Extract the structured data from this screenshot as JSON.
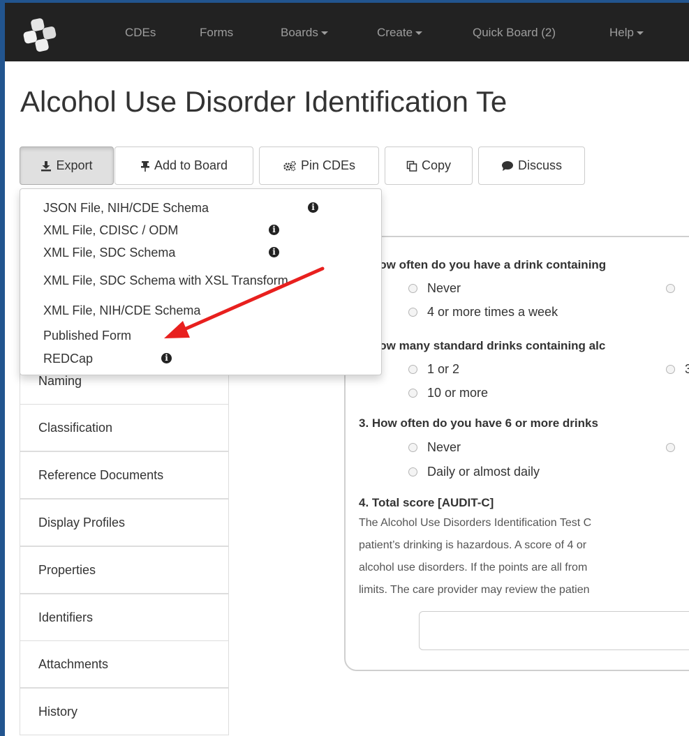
{
  "navbar": {
    "items": [
      {
        "label": "CDEs",
        "dropdown": false
      },
      {
        "label": "Forms",
        "dropdown": false
      },
      {
        "label": "Boards",
        "dropdown": true
      },
      {
        "label": "Create",
        "dropdown": true
      },
      {
        "label": "Quick Board (2)",
        "dropdown": false
      },
      {
        "label": "Help",
        "dropdown": true
      }
    ]
  },
  "page": {
    "title": "Alcohol Use Disorder Identification Te"
  },
  "toolbar": {
    "export_label": "Export",
    "add_to_board_label": "Add to Board",
    "pin_cdes_label": "Pin CDEs",
    "copy_label": "Copy",
    "discuss_label": "Discuss"
  },
  "export_menu": {
    "items": [
      {
        "label": "JSON File, NIH/CDE Schema",
        "info": true
      },
      {
        "label": "XML File, CDISC / ODM",
        "info": true
      },
      {
        "label": "XML File, SDC Schema",
        "info": true
      },
      {
        "label": "XML File, SDC Schema with XSL Transform",
        "info": false
      },
      {
        "label": "XML File, NIH/CDE Schema",
        "info": false
      },
      {
        "label": "Published Form",
        "info": false
      },
      {
        "label": "REDCap",
        "info": true
      }
    ]
  },
  "sidebar": {
    "items": [
      {
        "label": "Naming"
      },
      {
        "label": "Classification"
      },
      {
        "label": "Reference Documents"
      },
      {
        "label": "Display Profiles"
      },
      {
        "label": "Properties"
      },
      {
        "label": "Identifiers"
      },
      {
        "label": "Attachments"
      },
      {
        "label": "History"
      }
    ]
  },
  "form": {
    "q1": {
      "text": "How often do you have a drink containing",
      "options": [
        "Never",
        "4 or more times a week"
      ]
    },
    "q2": {
      "text": "How many standard drinks containing alc",
      "options": [
        "1 or 2",
        "10 or more"
      ],
      "partial_option": "3"
    },
    "q3": {
      "text": "3. How often do you have 6 or more drinks",
      "options": [
        "Never",
        "Daily or almost daily"
      ]
    },
    "q4": {
      "text": "4. Total score [AUDIT-C]",
      "description_lines": [
        "The Alcohol Use Disorders Identification Test C",
        "patient’s drinking is hazardous. A score of 4 or",
        "alcohol use disorders. If the points are all from",
        "limits. The care provider may review the patien"
      ],
      "input_value": ""
    }
  },
  "colors": {
    "navbar_bg": "#222222",
    "navbar_text": "#9d9d9d",
    "frame": "#22558f",
    "annotation_arrow": "#e8201e",
    "active_tab_accent": "#337ab7"
  }
}
